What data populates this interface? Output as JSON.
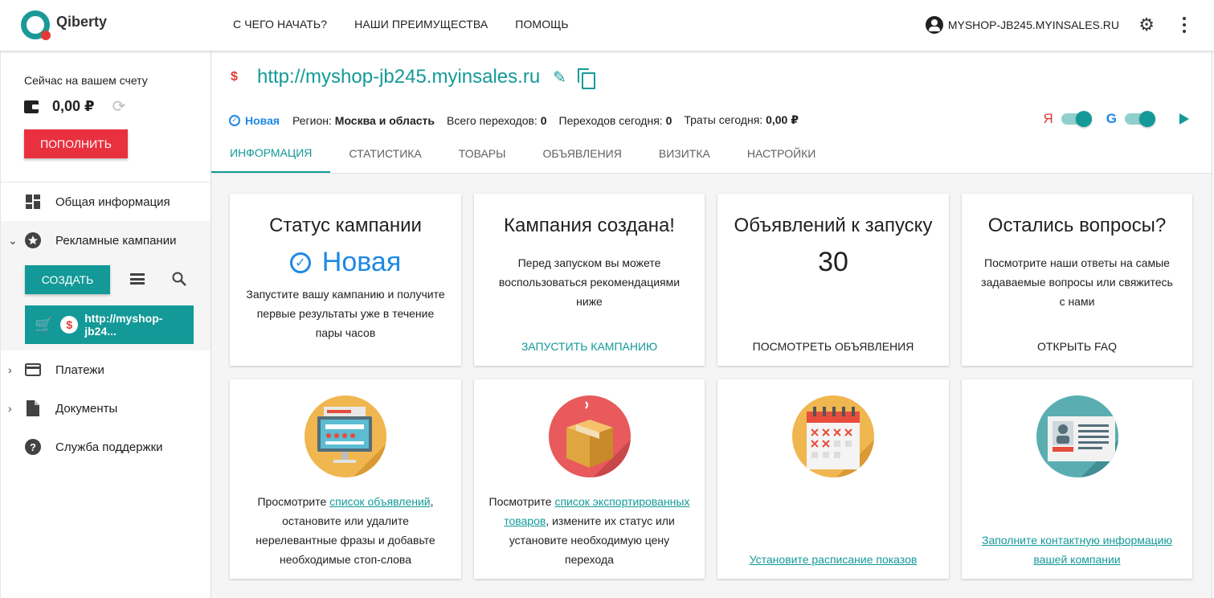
{
  "header": {
    "logo_text": "Qiberty",
    "nav": [
      "С ЧЕГО НАЧАТЬ?",
      "НАШИ ПРЕИМУЩЕСТВА",
      "ПОМОЩЬ"
    ],
    "account_label": "MYSHOP-JB245.MYINSALES.RU"
  },
  "sidebar": {
    "balance_label": "Сейчас на вашем счету",
    "balance_amount": "0,00 ₽",
    "topup_label": "ПОПОЛНИТЬ",
    "items": {
      "general": "Общая информация",
      "campaigns": "Рекламные кампании",
      "payments": "Платежи",
      "documents": "Документы",
      "support": "Служба поддержки"
    },
    "create_label": "СОЗДАТЬ",
    "campaign_chip": "http://myshop-jb24..."
  },
  "main": {
    "site_url": "http://myshop-jb245.myinsales.ru",
    "status": "Новая",
    "region_label": "Регион:",
    "region_value": "Москва и область",
    "total_clicks_label": "Всего переходов:",
    "total_clicks_value": "0",
    "today_clicks_label": "Переходов сегодня:",
    "today_clicks_value": "0",
    "spend_today_label": "Траты сегодня:",
    "spend_today_value": "0,00 ₽",
    "engine_yandex": "Я",
    "engine_google": "G",
    "tabs": [
      "ИНФОРМАЦИЯ",
      "СТАТИСТИКА",
      "ТОВАРЫ",
      "ОБЪЯВЛЕНИЯ",
      "ВИЗИТКА",
      "НАСТРОЙКИ"
    ]
  },
  "cards": {
    "status": {
      "title": "Статус кампании",
      "value": "Новая",
      "text": "Запустите вашу кампанию и получите первые результаты уже в течение пары часов"
    },
    "created": {
      "title": "Кампания создана!",
      "text": "Перед запуском вы можете воспользоваться рекомендациями ниже",
      "action": "ЗАПУСТИТЬ КАМПАНИЮ"
    },
    "ads": {
      "title": "Объявлений к запуску",
      "value": "30",
      "action": "ПОСМОТРЕТЬ ОБЪЯВЛЕНИЯ"
    },
    "questions": {
      "title": "Остались вопросы?",
      "text": "Посмотрите наши ответы на самые задаваемые вопросы или свяжитесь с нами",
      "action": "ОТКРЫТЬ FAQ"
    },
    "tip1": {
      "pre": "Просмотрите ",
      "link": "список объявлений",
      "post": ", остановите или удалите нерелевантные фразы и добавьте необходимые стоп-слова"
    },
    "tip2": {
      "pre": "Посмотрите ",
      "link": "список экспортированных товаров",
      "post": ", измените их статус или установите необходимую цену перехода"
    },
    "tip3": {
      "link": "Установите расписание показов"
    },
    "tip4": {
      "link": "Заполните контактную информацию вашей компании"
    }
  },
  "colors": {
    "accent": "#139a98",
    "danger": "#e9303e",
    "status_blue": "#1e88e5"
  }
}
